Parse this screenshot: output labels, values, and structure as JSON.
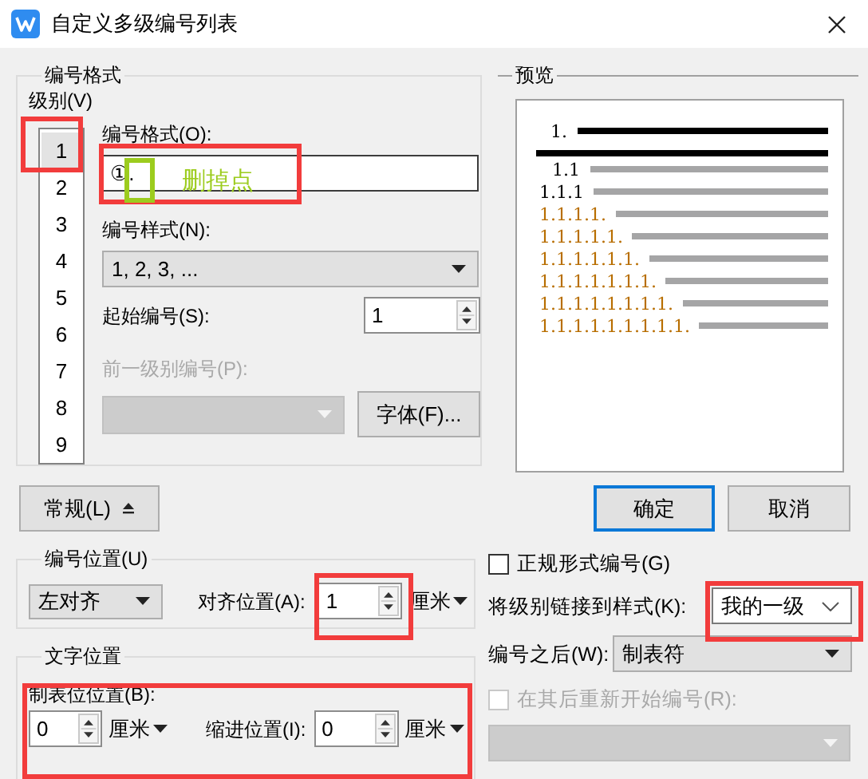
{
  "window": {
    "title": "自定义多级编号列表"
  },
  "number_format": {
    "legend": "编号格式",
    "level_label": "级别(V)",
    "levels": [
      {
        "label": "1",
        "selected": true
      },
      {
        "label": "2",
        "selected": false
      },
      {
        "label": "3",
        "selected": false
      },
      {
        "label": "4",
        "selected": false
      },
      {
        "label": "5",
        "selected": false
      },
      {
        "label": "6",
        "selected": false
      },
      {
        "label": "7",
        "selected": false
      },
      {
        "label": "8",
        "selected": false
      },
      {
        "label": "9",
        "selected": false
      }
    ],
    "format_label": "编号格式(O):",
    "format_value": "①.",
    "style_label": "编号样式(N):",
    "style_value": "1, 2, 3, ...",
    "start_label": "起始编号(S):",
    "start_value": "1",
    "previous_label": "前一级别编号(P):",
    "previous_disabled": true,
    "font_button": "字体(F)..."
  },
  "preview": {
    "legend": "预览",
    "lines": [
      {
        "text": "1.",
        "color": "#000000"
      },
      {
        "text": "1.1",
        "color": "#000000"
      },
      {
        "text": "1.1.1",
        "color": "#000000"
      },
      {
        "text": "1.1.1.1.",
        "color": "#b86e00"
      },
      {
        "text": "1.1.1.1.1.",
        "color": "#b86e00"
      },
      {
        "text": "1.1.1.1.1.1.",
        "color": "#b86e00"
      },
      {
        "text": "1.1.1.1.1.1.1.",
        "color": "#b86e00"
      },
      {
        "text": "1.1.1.1.1.1.1.1.",
        "color": "#b86e00"
      },
      {
        "text": "1.1.1.1.1.1.1.1.1.",
        "color": "#b86e00"
      }
    ]
  },
  "general_button": "常规(L)",
  "ok_button": "确定",
  "cancel_button": "取消",
  "number_position": {
    "legend": "编号位置(U)",
    "alignment": "左对齐",
    "align_at_label": "对齐位置(A):",
    "align_at_value": "1",
    "unit": "厘米"
  },
  "text_position": {
    "legend": "文字位置",
    "tab_label": "制表位位置(B):",
    "tab_value": "0",
    "tab_unit": "厘米",
    "indent_label": "缩进位置(I):",
    "indent_value": "0",
    "indent_unit": "厘米"
  },
  "options": {
    "legal_label": "正规形式编号(G)",
    "legal_checked": false,
    "link_label": "将级别链接到样式(K):",
    "link_value": "我的一级",
    "follow_label": "编号之后(W):",
    "follow_value": "制表符",
    "restart_label": "在其后重新开始编号(R):",
    "restart_checked": false,
    "restart_disabled": true
  },
  "annotations": [
    {
      "text": "删掉点"
    }
  ]
}
